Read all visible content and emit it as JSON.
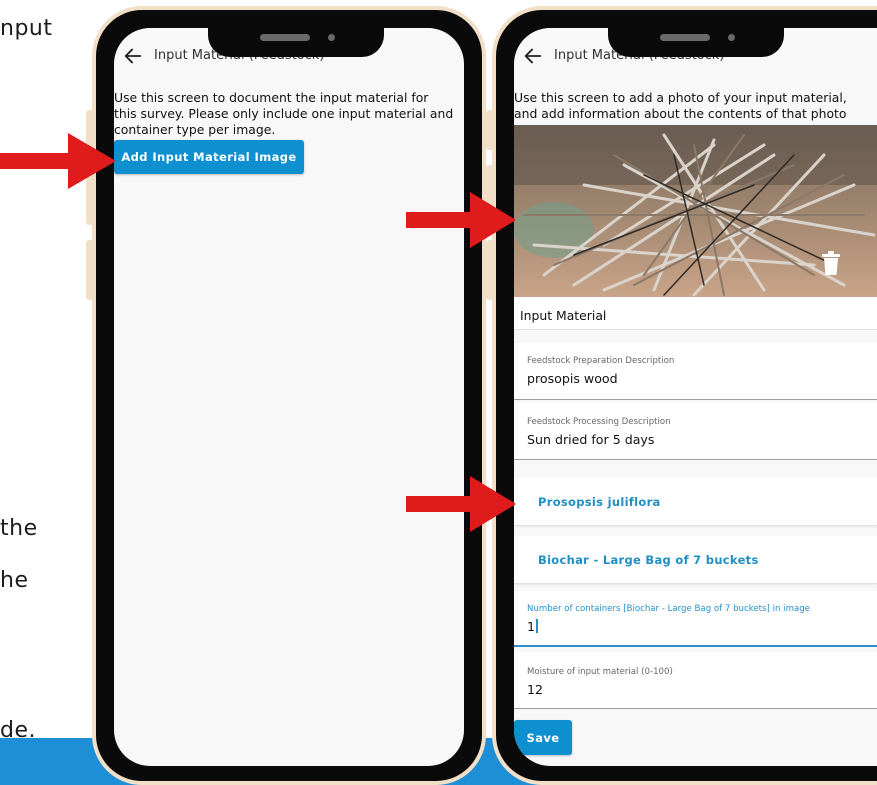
{
  "background_text": {
    "line1": "nput",
    "line2": "the",
    "line3": "he",
    "line4": "de."
  },
  "colors": {
    "accent": "#0d8fd0",
    "link": "#1f8fc4",
    "arrow": "#e01b1b",
    "band": "#1e8fd6",
    "frame": "#f2dfc8"
  },
  "phone1": {
    "header": {
      "title": "Input Material (Feedstock)",
      "back_icon": "back-arrow-icon"
    },
    "intro_lines": [
      "Use this screen to document the input material for",
      "this survey. Please only include one input material and",
      "container type per image."
    ],
    "add_button": "Add Input Material Image"
  },
  "phone2": {
    "header": {
      "title": "Input Material (Feedstock)",
      "back_icon": "back-arrow-icon"
    },
    "intro_lines": [
      "Use this screen to add a photo of your input material,",
      "and add information about the contents of that photo"
    ],
    "photo": {
      "alt": "pile of prosopis wood sticks",
      "delete_icon": "trash-icon"
    },
    "section_label": "Input Material",
    "fields": [
      {
        "label": "Feedstock Preparation Description",
        "value": "prosopis wood"
      },
      {
        "label": "Feedstock Processing Description",
        "value": "Sun dried for 5 days"
      }
    ],
    "species_link": "Prosopsis juliflora",
    "container_link": "Biochar - Large Bag of 7 buckets",
    "containers_field": {
      "label": "Number of containers [Biochar - Large Bag of 7 buckets]  in image",
      "value": "1"
    },
    "moisture_field": {
      "label": "Moisture of input material (0-100)",
      "value": "12"
    },
    "save_button": "Save"
  }
}
